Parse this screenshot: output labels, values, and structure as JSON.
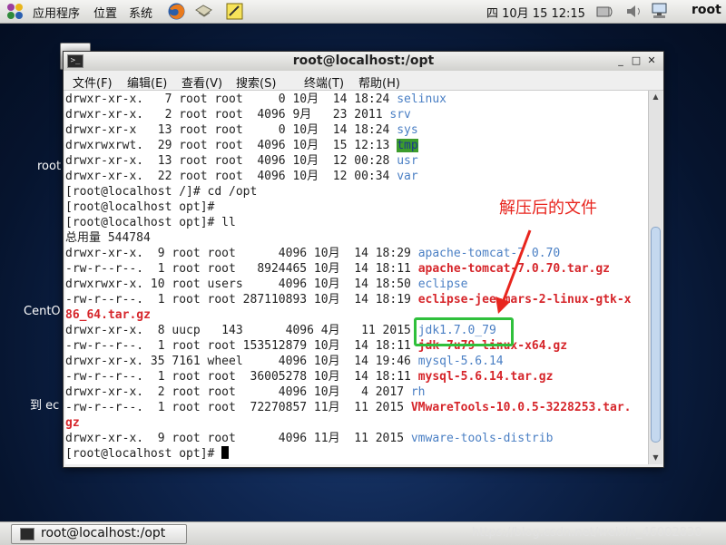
{
  "top_panel": {
    "menus": [
      "应用程序",
      "位置",
      "系统"
    ],
    "clock": "四 10月 15 12:15",
    "user": "root"
  },
  "desktop": {
    "icon_labels": [
      "root",
      "CentO",
      "到 ec"
    ]
  },
  "window": {
    "title": "root@localhost:/opt",
    "menu": [
      "文件(F)",
      "编辑(E)",
      "查看(V)",
      "搜索(S)",
      "终端(T)",
      "帮助(H)"
    ]
  },
  "terminal": {
    "lines": [
      [
        [
          "drwxr-xr-x.   7 root root     0 10月  14 18:24 ",
          ""
        ],
        [
          "selinux",
          "blue"
        ]
      ],
      [
        [
          "drwxr-xr-x.   2 root root  4096 9月   23 2011 ",
          ""
        ],
        [
          "srv",
          "blue"
        ]
      ],
      [
        [
          "drwxr-xr-x   13 root root     0 10月  14 18:24 ",
          ""
        ],
        [
          "sys",
          "blue"
        ]
      ],
      [
        [
          "drwxrwxrwt.  29 root root  4096 10月  15 12:13 ",
          ""
        ],
        [
          "tmp",
          "tmp"
        ]
      ],
      [
        [
          "drwxr-xr-x.  13 root root  4096 10月  12 00:28 ",
          ""
        ],
        [
          "usr",
          "blue"
        ]
      ],
      [
        [
          "drwxr-xr-x.  22 root root  4096 10月  12 00:34 ",
          ""
        ],
        [
          "var",
          "blue"
        ]
      ],
      [
        [
          "[root@localhost /]# cd /opt",
          ""
        ]
      ],
      [
        [
          "[root@localhost opt]# ",
          ""
        ]
      ],
      [
        [
          "[root@localhost opt]# ll",
          ""
        ]
      ],
      [
        [
          "总用量 544784",
          ""
        ]
      ],
      [
        [
          "drwxr-xr-x.  9 root root      4096 10月  14 18:29 ",
          ""
        ],
        [
          "apache-tomcat-7.0.70",
          "blue"
        ]
      ],
      [
        [
          "-rw-r--r--.  1 root root   8924465 10月  14 18:11 ",
          ""
        ],
        [
          "apache-tomcat-7.0.70.tar.gz",
          "red"
        ]
      ],
      [
        [
          "drwxrwxr-x. 10 root users     4096 10月  14 18:50 ",
          ""
        ],
        [
          "eclipse",
          "blue"
        ]
      ],
      [
        [
          "-rw-r--r--.  1 root root 287110893 10月  14 18:19 ",
          ""
        ],
        [
          "eclipse-jee-mars-2-linux-gtk-x",
          "red"
        ]
      ],
      [
        [
          "86_64.tar.gz",
          "red"
        ]
      ],
      [
        [
          "drwxr-xr-x.  8 uucp   143      4096 4月   11 2015 ",
          ""
        ],
        [
          "jdk1.7.0_79",
          "blue"
        ]
      ],
      [
        [
          "-rw-r--r--.  1 root root 153512879 10月  14 18:11 ",
          ""
        ],
        [
          "jdk-7u79-linux-x64.gz",
          "red"
        ]
      ],
      [
        [
          "drwxr-xr-x. 35 7161 wheel     4096 10月  14 19:46 ",
          ""
        ],
        [
          "mysql-5.6.14",
          "blue"
        ]
      ],
      [
        [
          "-rw-r--r--.  1 root root  36005278 10月  14 18:11 ",
          ""
        ],
        [
          "mysql-5.6.14.tar.gz",
          "red"
        ]
      ],
      [
        [
          "drwxr-xr-x.  2 root root      4096 10月   4 2017 ",
          ""
        ],
        [
          "rh",
          "blue"
        ]
      ],
      [
        [
          "-rw-r--r--.  1 root root  72270857 11月  11 2015 ",
          ""
        ],
        [
          "VMwareTools-10.0.5-3228253.tar.",
          "red"
        ]
      ],
      [
        [
          "gz",
          "red"
        ]
      ],
      [
        [
          "drwxr-xr-x.  9 root root      4096 11月  11 2015 ",
          ""
        ],
        [
          "vmware-tools-distrib",
          "blue"
        ]
      ],
      [
        [
          "[root@localhost opt]# ",
          ""
        ]
      ]
    ],
    "scroll_position": 0.93,
    "scroll_visible_fraction": 0.62
  },
  "annotation": {
    "label": "解压后的文件",
    "color": "#e8251e",
    "highlight_color": "#2fc03c"
  },
  "bottom_panel": {
    "task_label": "root@localhost:/opt",
    "watermark": "https://blog.csdn.net/weixin_46002838"
  }
}
